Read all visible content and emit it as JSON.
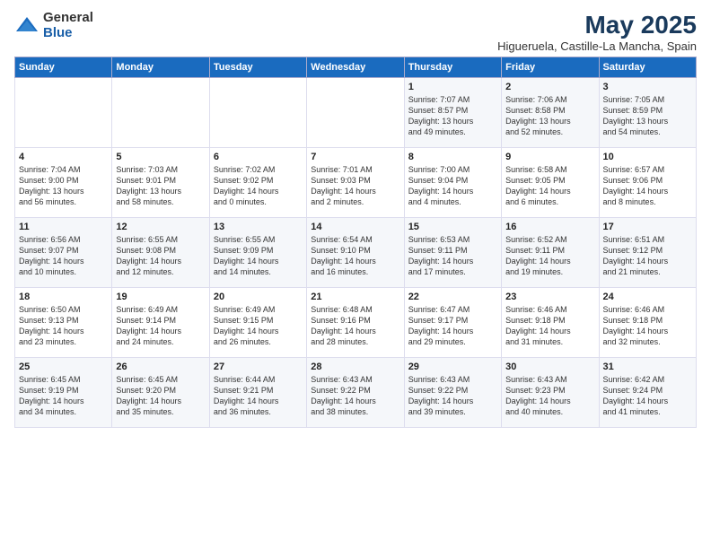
{
  "logo": {
    "general": "General",
    "blue": "Blue"
  },
  "title": "May 2025",
  "subtitle": "Higueruela, Castille-La Mancha, Spain",
  "days_of_week": [
    "Sunday",
    "Monday",
    "Tuesday",
    "Wednesday",
    "Thursday",
    "Friday",
    "Saturday"
  ],
  "weeks": [
    [
      {
        "day": "",
        "info": ""
      },
      {
        "day": "",
        "info": ""
      },
      {
        "day": "",
        "info": ""
      },
      {
        "day": "",
        "info": ""
      },
      {
        "day": "1",
        "info": "Sunrise: 7:07 AM\nSunset: 8:57 PM\nDaylight: 13 hours\nand 49 minutes."
      },
      {
        "day": "2",
        "info": "Sunrise: 7:06 AM\nSunset: 8:58 PM\nDaylight: 13 hours\nand 52 minutes."
      },
      {
        "day": "3",
        "info": "Sunrise: 7:05 AM\nSunset: 8:59 PM\nDaylight: 13 hours\nand 54 minutes."
      }
    ],
    [
      {
        "day": "4",
        "info": "Sunrise: 7:04 AM\nSunset: 9:00 PM\nDaylight: 13 hours\nand 56 minutes."
      },
      {
        "day": "5",
        "info": "Sunrise: 7:03 AM\nSunset: 9:01 PM\nDaylight: 13 hours\nand 58 minutes."
      },
      {
        "day": "6",
        "info": "Sunrise: 7:02 AM\nSunset: 9:02 PM\nDaylight: 14 hours\nand 0 minutes."
      },
      {
        "day": "7",
        "info": "Sunrise: 7:01 AM\nSunset: 9:03 PM\nDaylight: 14 hours\nand 2 minutes."
      },
      {
        "day": "8",
        "info": "Sunrise: 7:00 AM\nSunset: 9:04 PM\nDaylight: 14 hours\nand 4 minutes."
      },
      {
        "day": "9",
        "info": "Sunrise: 6:58 AM\nSunset: 9:05 PM\nDaylight: 14 hours\nand 6 minutes."
      },
      {
        "day": "10",
        "info": "Sunrise: 6:57 AM\nSunset: 9:06 PM\nDaylight: 14 hours\nand 8 minutes."
      }
    ],
    [
      {
        "day": "11",
        "info": "Sunrise: 6:56 AM\nSunset: 9:07 PM\nDaylight: 14 hours\nand 10 minutes."
      },
      {
        "day": "12",
        "info": "Sunrise: 6:55 AM\nSunset: 9:08 PM\nDaylight: 14 hours\nand 12 minutes."
      },
      {
        "day": "13",
        "info": "Sunrise: 6:55 AM\nSunset: 9:09 PM\nDaylight: 14 hours\nand 14 minutes."
      },
      {
        "day": "14",
        "info": "Sunrise: 6:54 AM\nSunset: 9:10 PM\nDaylight: 14 hours\nand 16 minutes."
      },
      {
        "day": "15",
        "info": "Sunrise: 6:53 AM\nSunset: 9:11 PM\nDaylight: 14 hours\nand 17 minutes."
      },
      {
        "day": "16",
        "info": "Sunrise: 6:52 AM\nSunset: 9:11 PM\nDaylight: 14 hours\nand 19 minutes."
      },
      {
        "day": "17",
        "info": "Sunrise: 6:51 AM\nSunset: 9:12 PM\nDaylight: 14 hours\nand 21 minutes."
      }
    ],
    [
      {
        "day": "18",
        "info": "Sunrise: 6:50 AM\nSunset: 9:13 PM\nDaylight: 14 hours\nand 23 minutes."
      },
      {
        "day": "19",
        "info": "Sunrise: 6:49 AM\nSunset: 9:14 PM\nDaylight: 14 hours\nand 24 minutes."
      },
      {
        "day": "20",
        "info": "Sunrise: 6:49 AM\nSunset: 9:15 PM\nDaylight: 14 hours\nand 26 minutes."
      },
      {
        "day": "21",
        "info": "Sunrise: 6:48 AM\nSunset: 9:16 PM\nDaylight: 14 hours\nand 28 minutes."
      },
      {
        "day": "22",
        "info": "Sunrise: 6:47 AM\nSunset: 9:17 PM\nDaylight: 14 hours\nand 29 minutes."
      },
      {
        "day": "23",
        "info": "Sunrise: 6:46 AM\nSunset: 9:18 PM\nDaylight: 14 hours\nand 31 minutes."
      },
      {
        "day": "24",
        "info": "Sunrise: 6:46 AM\nSunset: 9:18 PM\nDaylight: 14 hours\nand 32 minutes."
      }
    ],
    [
      {
        "day": "25",
        "info": "Sunrise: 6:45 AM\nSunset: 9:19 PM\nDaylight: 14 hours\nand 34 minutes."
      },
      {
        "day": "26",
        "info": "Sunrise: 6:45 AM\nSunset: 9:20 PM\nDaylight: 14 hours\nand 35 minutes."
      },
      {
        "day": "27",
        "info": "Sunrise: 6:44 AM\nSunset: 9:21 PM\nDaylight: 14 hours\nand 36 minutes."
      },
      {
        "day": "28",
        "info": "Sunrise: 6:43 AM\nSunset: 9:22 PM\nDaylight: 14 hours\nand 38 minutes."
      },
      {
        "day": "29",
        "info": "Sunrise: 6:43 AM\nSunset: 9:22 PM\nDaylight: 14 hours\nand 39 minutes."
      },
      {
        "day": "30",
        "info": "Sunrise: 6:43 AM\nSunset: 9:23 PM\nDaylight: 14 hours\nand 40 minutes."
      },
      {
        "day": "31",
        "info": "Sunrise: 6:42 AM\nSunset: 9:24 PM\nDaylight: 14 hours\nand 41 minutes."
      }
    ]
  ]
}
